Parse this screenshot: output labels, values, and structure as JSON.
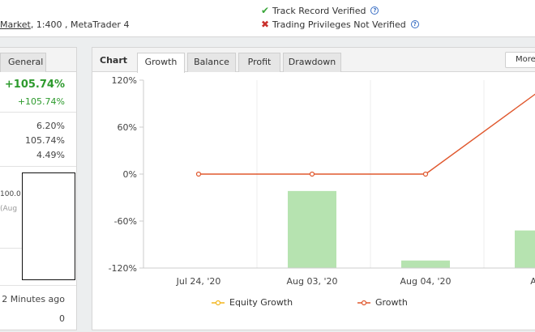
{
  "header": {
    "broker_link": "Market",
    "broker_rest": ", 1:400 , MetaTrader 4",
    "track_record": "Track Record Verified",
    "trading_privileges": "Trading Privileges Not Verified",
    "help_glyph": "?"
  },
  "left_panel": {
    "tab_general": "General",
    "gain_main": "+105.74%",
    "gain_secondary": "+105.74%",
    "stats": [
      "6.20%",
      "105.74%",
      "4.49%"
    ],
    "fragment_value": "100.0",
    "fragment_date": "(Aug",
    "updated": "2 Minutes ago",
    "count": "0"
  },
  "chart_panel": {
    "title": "Chart",
    "tabs": [
      "Growth",
      "Balance",
      "Profit",
      "Drawdown"
    ],
    "active_tab": "Growth",
    "more_button": "More"
  },
  "colors": {
    "growth_line": "#e0582e",
    "equity_line": "#f2b61e",
    "bars": "#b6e3b0",
    "gain_green": "#2d9a2d",
    "check_green": "#3aa63a",
    "cross_red": "#c9302c"
  },
  "chart_data": {
    "type": "line",
    "x": [
      "Jul 24, '20",
      "Aug 03, '20",
      "Aug 04, '20",
      "Aug"
    ],
    "ylim": [
      -120,
      120
    ],
    "yticks": [
      "120%",
      "60%",
      "0%",
      "-60%",
      "-120%"
    ],
    "series": [
      {
        "name": "Equity Growth",
        "kind": "line",
        "values": []
      },
      {
        "name": "Growth",
        "kind": "line",
        "values": [
          0,
          0,
          0,
          105.74
        ]
      },
      {
        "name": "",
        "kind": "bar",
        "values": [
          0,
          41,
          4,
          20
        ]
      }
    ],
    "legend": [
      "Equity Growth",
      "Growth"
    ],
    "legend_position": "bottom",
    "grid": true
  }
}
